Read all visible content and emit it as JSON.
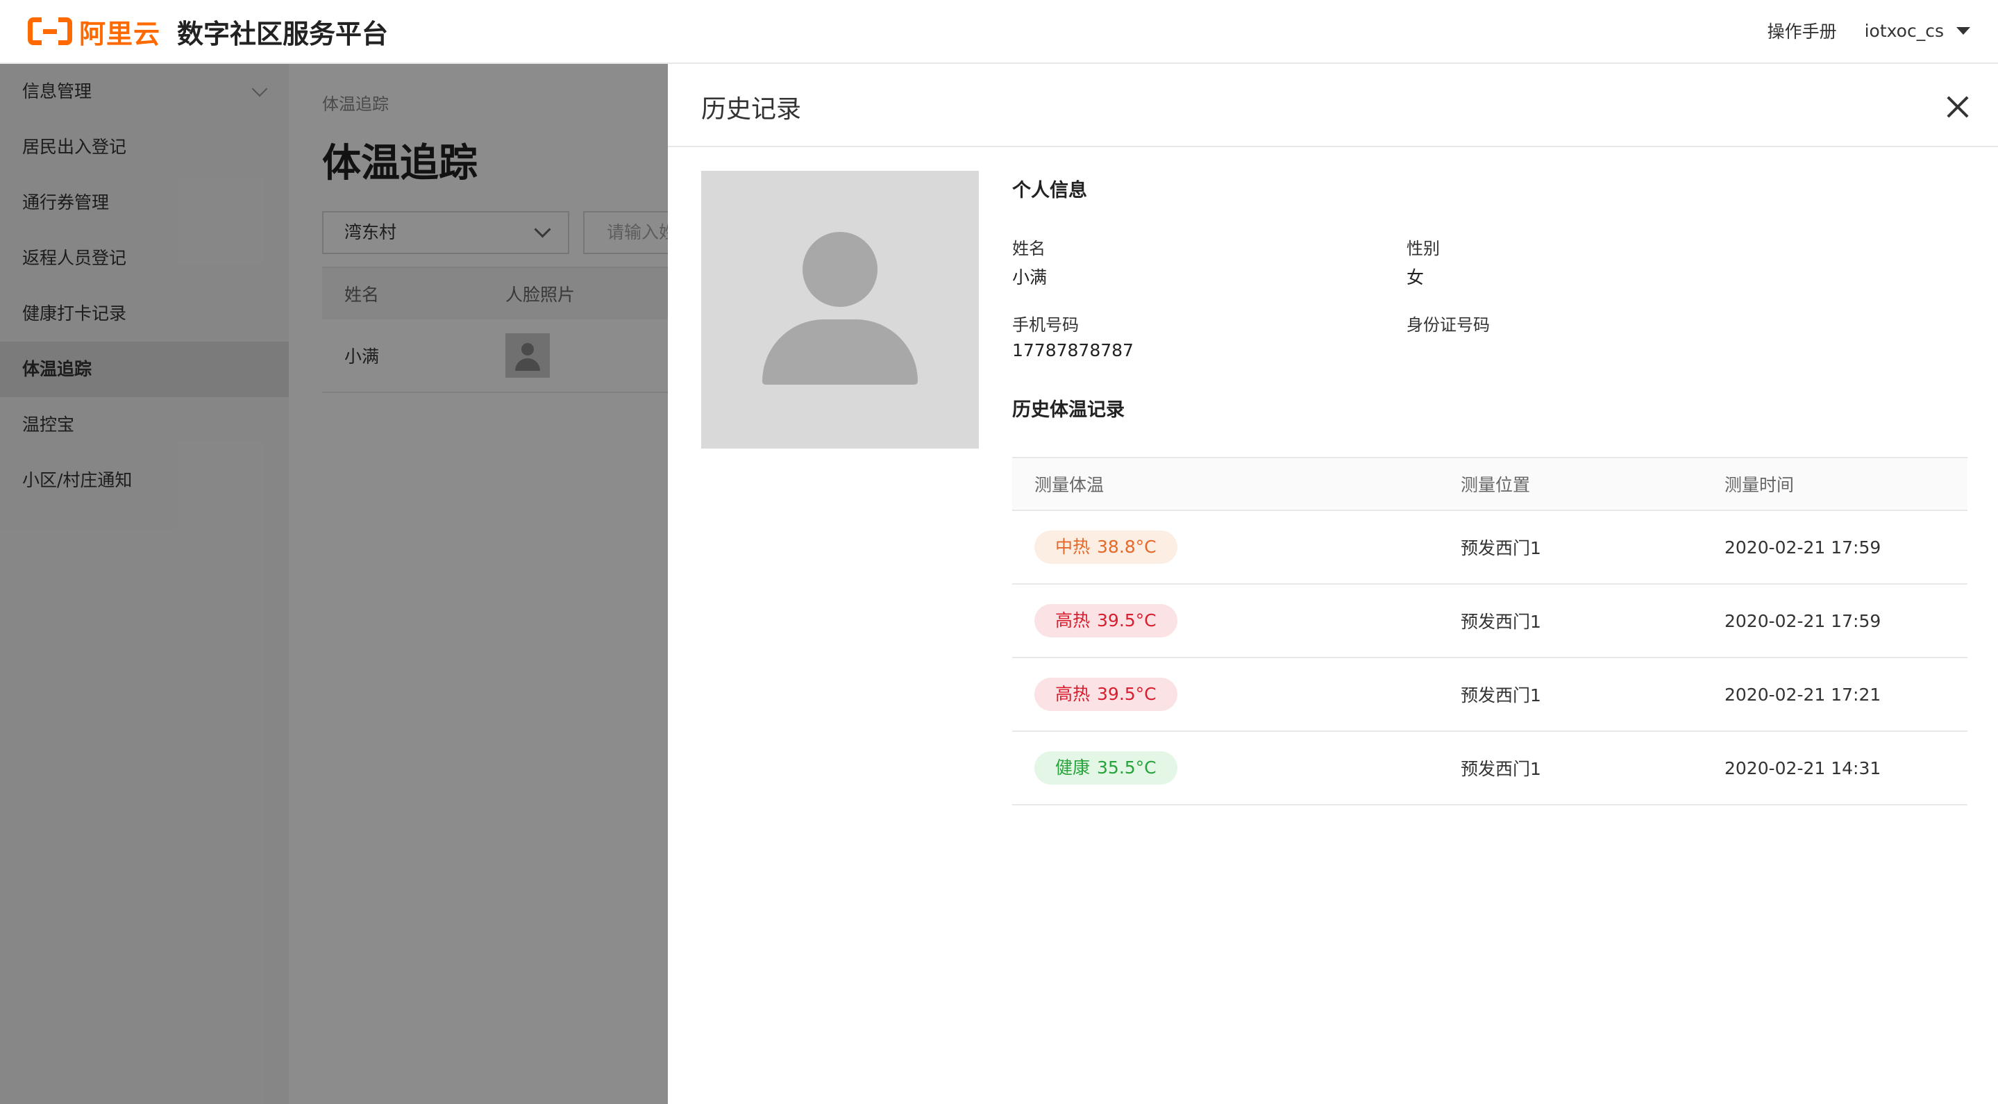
{
  "header": {
    "logo_text": "阿里云",
    "app_title": "数字社区服务平台",
    "manual_label": "操作手册",
    "username": "iotxoc_cs"
  },
  "sidebar": {
    "items": [
      {
        "label": "信息管理"
      },
      {
        "label": "居民出入登记"
      },
      {
        "label": "通行券管理"
      },
      {
        "label": "返程人员登记"
      },
      {
        "label": "健康打卡记录"
      },
      {
        "label": "体温追踪"
      },
      {
        "label": "温控宝"
      },
      {
        "label": "小区/村庄通知"
      }
    ],
    "active_index": 5
  },
  "main": {
    "breadcrumb": "体温追踪",
    "title": "体温追踪",
    "village_select": "湾东村",
    "search_placeholder": "请输入姓",
    "table": {
      "columns": [
        "姓名",
        "人脸照片"
      ],
      "rows": [
        {
          "name": "小满"
        }
      ]
    }
  },
  "drawer": {
    "title": "历史记录",
    "personal_info_title": "个人信息",
    "fields": {
      "name_label": "姓名",
      "name_value": "小满",
      "gender_label": "性别",
      "gender_value": "女",
      "phone_label": "手机号码",
      "phone_value": "17787878787",
      "id_label": "身份证号码",
      "id_value": ""
    },
    "history_title": "历史体温记录",
    "history_columns": [
      "测量体温",
      "测量位置",
      "测量时间"
    ],
    "history_rows": [
      {
        "status": "中热",
        "temp": "38.8°C",
        "location": "预发西门1",
        "time": "2020-02-21 17:59"
      },
      {
        "status": "高热",
        "temp": "39.5°C",
        "location": "预发西门1",
        "time": "2020-02-21 17:59"
      },
      {
        "status": "高热",
        "temp": "39.5°C",
        "location": "预发西门1",
        "time": "2020-02-21 17:21"
      },
      {
        "status": "健康",
        "temp": "35.5°C",
        "location": "预发西门1",
        "time": "2020-02-21 14:31"
      }
    ]
  },
  "colors": {
    "brand": "#ff6a00",
    "medium_fever_text": "#e6692a",
    "medium_fever_bg": "#fdeee4",
    "high_fever_text": "#d81e2f",
    "high_fever_bg": "#fbe3e5",
    "healthy_text": "#26a33a",
    "healthy_bg": "#e4f7e6"
  }
}
